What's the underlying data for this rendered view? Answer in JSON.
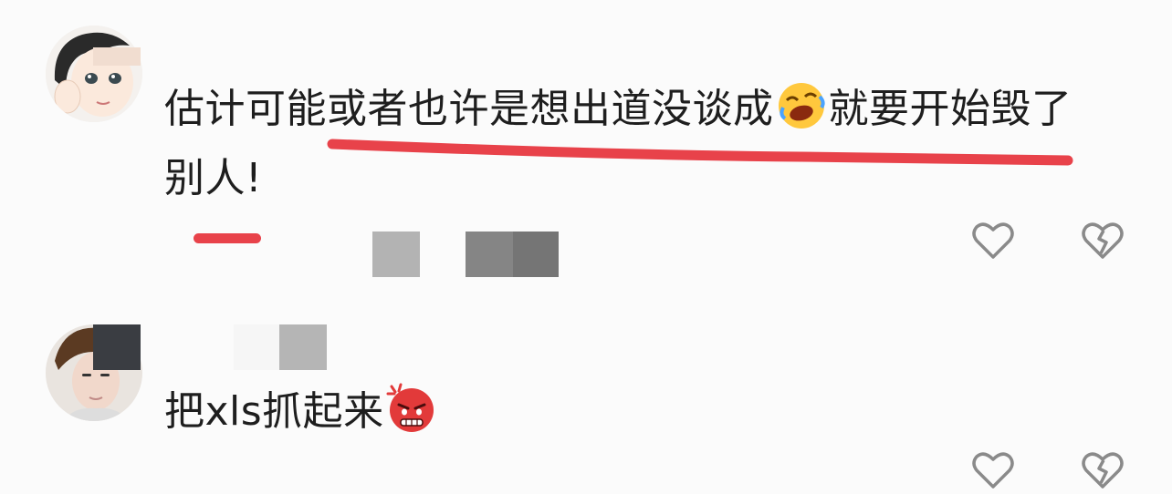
{
  "comments": [
    {
      "text_line1": "估计可能或者也许是想出道没谈成",
      "text_line1_after_emoji": "就要开始毁了",
      "text_line2": "别人!",
      "emoji": "rolling-on-floor-laughing"
    },
    {
      "text": "把xls抓起来",
      "emoji": "angry-face"
    }
  ],
  "colors": {
    "annotation_red": "#e8424a",
    "text": "#1e1e1e",
    "icon_gray": "#888888",
    "background": "#fbfbfb"
  },
  "icons": [
    "like-icon",
    "dislike-icon"
  ]
}
